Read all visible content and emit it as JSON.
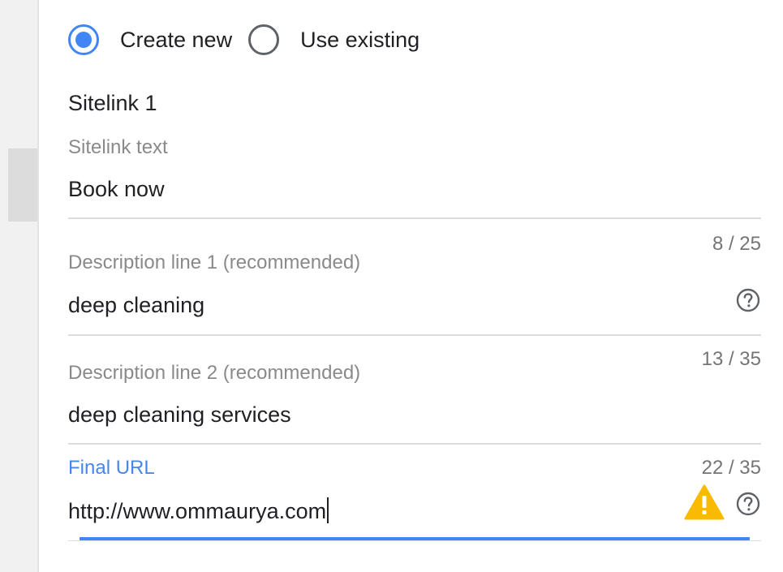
{
  "radio_group": {
    "options": [
      {
        "label": "Create new",
        "selected": true
      },
      {
        "label": "Use existing",
        "selected": false
      }
    ]
  },
  "sitelink": {
    "title": "Sitelink 1",
    "fields": {
      "text": {
        "label": "Sitelink text",
        "value": "Book now"
      },
      "description1": {
        "label": "Description line 1 (recommended)",
        "value": "deep cleaning",
        "counter": "8 / 25",
        "help_icon": "help-circle-icon"
      },
      "description2": {
        "label": "Description line 2 (recommended)",
        "value": "deep cleaning services",
        "counter": "13 / 35"
      },
      "final_url": {
        "label": "Final URL",
        "value": "http://www.ommaurya.com",
        "counter": "22 / 35",
        "warning_icon": "warning-triangle-icon",
        "help_icon": "help-circle-icon"
      }
    }
  },
  "colors": {
    "accent": "#4285f4",
    "active_label": "#4a86e8",
    "warning": "#f9ba00",
    "label_gray": "#8a8a8a",
    "divider": "#dadce0"
  }
}
